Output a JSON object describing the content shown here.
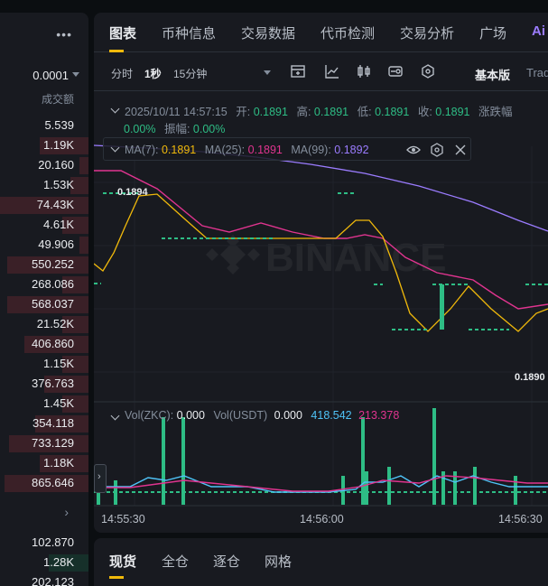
{
  "order_book": {
    "step": "0.0001",
    "column_header": "成交额",
    "ask_rows": [
      {
        "value": "5.539",
        "depth": 0
      },
      {
        "value": "1.19K",
        "depth": 0.55
      },
      {
        "value": "20.160",
        "depth": 0.1
      },
      {
        "value": "1.53K",
        "depth": 0.2
      },
      {
        "value": "74.43K",
        "depth": 1
      },
      {
        "value": "4.61K",
        "depth": 0.3
      },
      {
        "value": "49.906",
        "depth": 0.1
      },
      {
        "value": "550.252",
        "depth": 0.92
      },
      {
        "value": "268.086",
        "depth": 0.3
      },
      {
        "value": "568.037",
        "depth": 0.92
      },
      {
        "value": "21.52K",
        "depth": 0.3
      },
      {
        "value": "406.860",
        "depth": 0.72
      },
      {
        "value": "1.15K",
        "depth": 0.3
      },
      {
        "value": "376.763",
        "depth": 0.5
      },
      {
        "value": "1.45K",
        "depth": 0.3
      },
      {
        "value": "354.118",
        "depth": 0.6
      },
      {
        "value": "733.129",
        "depth": 0.9
      },
      {
        "value": "1.18K",
        "depth": 0.55
      },
      {
        "value": "865.646",
        "depth": 0.95
      }
    ],
    "bid_rows": [
      {
        "value": "102.870",
        "depth": 0
      },
      {
        "value": "1.28K",
        "depth": 0.45
      },
      {
        "value": "202.123",
        "depth": 0
      }
    ]
  },
  "tabs": [
    "图表",
    "币种信息",
    "交易数据",
    "代币检测",
    "交易分析",
    "广场"
  ],
  "ai_label": "Ai",
  "toolbar": {
    "interval_time": "分时",
    "interval_1s": "1秒",
    "interval_15m": "15分钟",
    "view_basic": "基本版",
    "view_trading": "Trad",
    "icons": [
      "calendar-add-icon",
      "line-chart-icon",
      "candlestick-icon",
      "indicator-settings-icon",
      "hexagon-settings-icon"
    ]
  },
  "candle_info": {
    "datetime": "2025/10/11 14:57:15",
    "open_label": "开:",
    "open": "0.1891",
    "high_label": "高:",
    "high": "0.1891",
    "low_label": "低:",
    "low": "0.1891",
    "close_label": "收:",
    "close": "0.1891",
    "change_label": "涨跌幅",
    "change_pct": "0.00%",
    "amplitude_label": "振幅:",
    "amplitude": "0.00%"
  },
  "ma": {
    "ma7_label": "MA(7):",
    "ma7": "0.1891",
    "ma25_label": "MA(25):",
    "ma25": "0.1891",
    "ma99_label": "MA(99):",
    "ma99": "0.1892"
  },
  "price_labels": {
    "upper": "0.1894",
    "lower": "0.1890"
  },
  "volume": {
    "zkc_label": "Vol(ZKC):",
    "zkc": "0.000",
    "usdt_label": "Vol(USDT)",
    "usdt": "0.000",
    "ma_a": "418.542",
    "ma_b": "213.378"
  },
  "time_axis": [
    "14:55:30",
    "14:56:00",
    "14:56:30"
  ],
  "bottom_tabs": [
    "现货",
    "全仓",
    "逐仓",
    "网格"
  ],
  "watermark": "BINANCE",
  "colors": {
    "accent": "#f0b90b",
    "up": "#2ebd85",
    "down": "#f6465d",
    "ma7": "#f0b90b",
    "ma25": "#e0348f",
    "ma99": "#9b7cff",
    "vol_ma_a": "#4fc3f7",
    "vol_ma_b": "#e0348f"
  }
}
